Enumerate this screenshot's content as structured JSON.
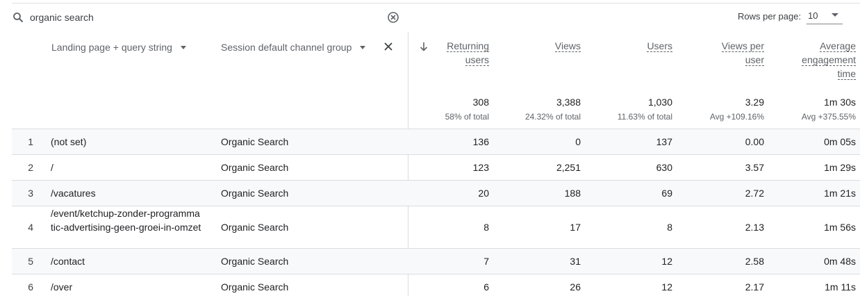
{
  "search": {
    "query": "organic search"
  },
  "pagination": {
    "rows_per_page_label": "Rows per page:",
    "rows_per_page_value": "10"
  },
  "columns": {
    "dimension1": "Landing page + query string",
    "dimension2": "Session default channel group",
    "metrics": [
      {
        "key": "returning_users",
        "lines": [
          "Returning",
          "users"
        ],
        "sorted": true,
        "sort_direction": "descending"
      },
      {
        "key": "views",
        "lines": [
          "Views"
        ]
      },
      {
        "key": "users",
        "lines": [
          "Users"
        ]
      },
      {
        "key": "views_per_user",
        "lines": [
          "Views per",
          "user"
        ]
      },
      {
        "key": "avg_engagement_time",
        "lines": [
          "Average",
          "engagement",
          "time"
        ]
      }
    ]
  },
  "totals": [
    {
      "value": "308",
      "sub": "58% of total"
    },
    {
      "value": "3,388",
      "sub": "24.32% of total"
    },
    {
      "value": "1,030",
      "sub": "11.63% of total"
    },
    {
      "value": "3.29",
      "sub": "Avg +109.16%"
    },
    {
      "value": "1m 30s",
      "sub": "Avg +375.55%"
    }
  ],
  "rows": [
    {
      "idx": "1",
      "page": "(not set)",
      "channel": "Organic Search",
      "values": [
        "136",
        "0",
        "137",
        "0.00",
        "0m 05s"
      ]
    },
    {
      "idx": "2",
      "page": "/",
      "channel": "Organic Search",
      "values": [
        "123",
        "2,251",
        "630",
        "3.57",
        "1m 29s"
      ]
    },
    {
      "idx": "3",
      "page": "/vacatures",
      "channel": "Organic Search",
      "values": [
        "20",
        "188",
        "69",
        "2.72",
        "1m 21s"
      ]
    },
    {
      "idx": "4",
      "page": "/event/ketchup-zonder-programmatic-advertising-geen-groei-in-omzet",
      "channel": "Organic Search",
      "values": [
        "8",
        "17",
        "8",
        "2.13",
        "1m 56s"
      ]
    },
    {
      "idx": "5",
      "page": "/contact",
      "channel": "Organic Search",
      "values": [
        "7",
        "31",
        "12",
        "2.58",
        "0m 48s"
      ]
    },
    {
      "idx": "6",
      "page": "/over",
      "channel": "Organic Search",
      "values": [
        "6",
        "26",
        "12",
        "2.17",
        "1m 11s"
      ]
    }
  ],
  "colors": {
    "row_shade": "#f8f9fa",
    "divider": "#dadce0",
    "text": "#202124",
    "muted": "#5f6368"
  }
}
